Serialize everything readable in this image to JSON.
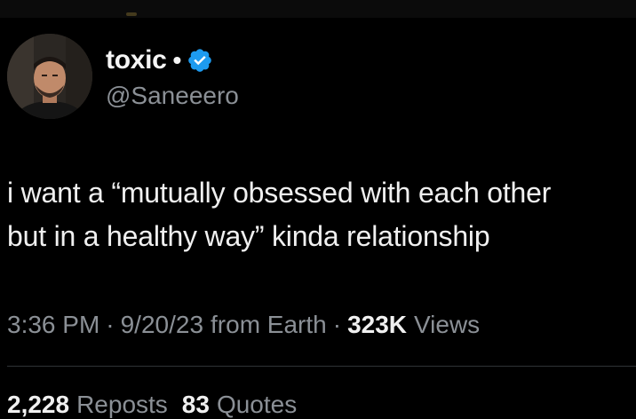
{
  "user": {
    "display_name": "toxic",
    "separator": "•",
    "handle": "@Saneeero",
    "verified_icon": "verified-badge-icon"
  },
  "tweet": {
    "lines": [
      "i want a “mutually obsessed with each other",
      "but in a healthy way” kinda relationship"
    ]
  },
  "meta": {
    "time": "3:36 PM",
    "date": "9/20/23",
    "source": "from Earth",
    "views_count": "323K",
    "views_label": "Views",
    "separator": "·"
  },
  "stats": {
    "reposts_count": "2,228",
    "reposts_label": "Reposts",
    "quotes_count": "83",
    "quotes_label": "Quotes"
  },
  "colors": {
    "background": "#000000",
    "text": "#e7e9ea",
    "secondary": "#8b9096",
    "verified": "#1d9bf0",
    "divider": "#2f3336"
  }
}
